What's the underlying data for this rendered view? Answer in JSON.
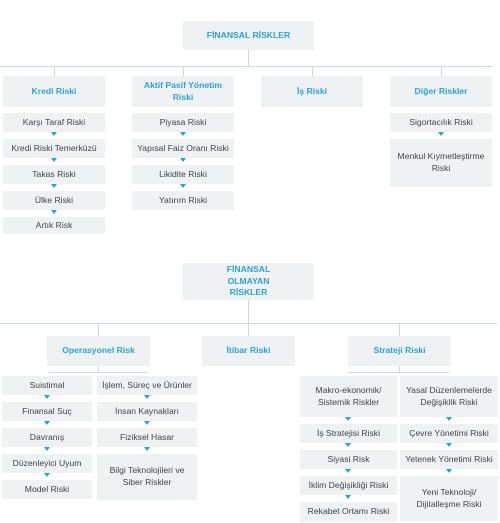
{
  "financial": {
    "title": "FİNANSAL RİSKLER",
    "categories": {
      "credit": "Kredi Riski",
      "alm": "Aktif Pasif Yönetim Riski",
      "business": "İş Riski",
      "other": "Diğer Riskler"
    },
    "credit_items": [
      "Karşı Taraf Riski",
      "Kredi Riski Temerküzü",
      "Takas Riski",
      "Ülke Riski",
      "Artık Risk"
    ],
    "alm_items": [
      "Piyasa Riski",
      "Yapısal Faiz Oranı Riski",
      "Likidite Riski",
      "Yatırım Riski"
    ],
    "other_items": [
      "Sigortacılık Riski",
      "Menkul Kıymetleştirme Riski"
    ]
  },
  "non_financial": {
    "title": "FİNANSAL OLMAYAN RİSKLER",
    "categories": {
      "operational": "Operasyonel Risk",
      "reputation": "İtibar Riski",
      "strategy": "Strateji Riski"
    },
    "operational_col1": [
      "Suistimal",
      "Finansal Suç",
      "Davranış",
      "Düzenleyici Uyum",
      "Model Riski"
    ],
    "operational_col2": [
      "İşlem, Süreç ve Ürünler",
      "İnsan Kaynakları",
      "Fiziksel Hasar",
      "Bilgi Teknolojileri ve Siber Riskler"
    ],
    "strategy_col1": [
      "Makro-ekonomik/ Sistemik Riskler",
      "İş Stratejisi Riski",
      "Siyasi Risk",
      "İklim Değişikliği Riski",
      "Rekabet Ortamı Riski"
    ],
    "strategy_col2": [
      "Yasal Düzenlemelerde Değişiklik Riski",
      "Çevre Yönetimi Riski",
      "Yetenek Yönetimi Riski",
      "Yeni Teknoloji/ Dijitalleşme Riski"
    ]
  },
  "colors": {
    "accent": "#2aa3d2",
    "box": "#f0f1f2",
    "connector": "#c6dbe7",
    "text": "#3d4450"
  }
}
